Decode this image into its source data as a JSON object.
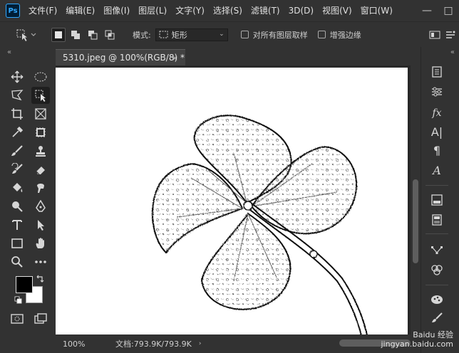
{
  "app": {
    "logo": "Ps"
  },
  "menu": [
    "文件(F)",
    "编辑(E)",
    "图像(I)",
    "图层(L)",
    "文字(Y)",
    "选择(S)",
    "滤镜(T)",
    "3D(D)",
    "视图(V)",
    "窗口(W)"
  ],
  "window_controls": {
    "minimize": "—",
    "maximize": "□"
  },
  "options": {
    "mode_label": "模式:",
    "mode_value": "矩形",
    "sample_all_layers": "对所有图层取样",
    "enhance_edge": "增强边缘",
    "icons": [
      "select-subject-icon",
      "settings-icon"
    ]
  },
  "tab": {
    "title": "5310.jpeg @ 100%(RGB/8) *",
    "close": "×"
  },
  "status": {
    "zoom": "100%",
    "doc": "文档:793.9K/793.9K",
    "arrow": "›"
  },
  "colors": {
    "foreground": "#000000",
    "background": "#ffffff",
    "accent": "#31a8ff"
  },
  "panel_icons": [
    "history-icon",
    "adjustments-icon",
    "styles-fx-icon",
    "character-icon",
    "paragraph-icon",
    "glyphs-icon",
    "swatches-icon",
    "layers-icon",
    "paths-icon",
    "channels-icon",
    "libraries-icon",
    "brush-settings-icon"
  ],
  "watermark": {
    "line1": "Baidu 经验",
    "line2": "jingyan.baidu.com"
  }
}
